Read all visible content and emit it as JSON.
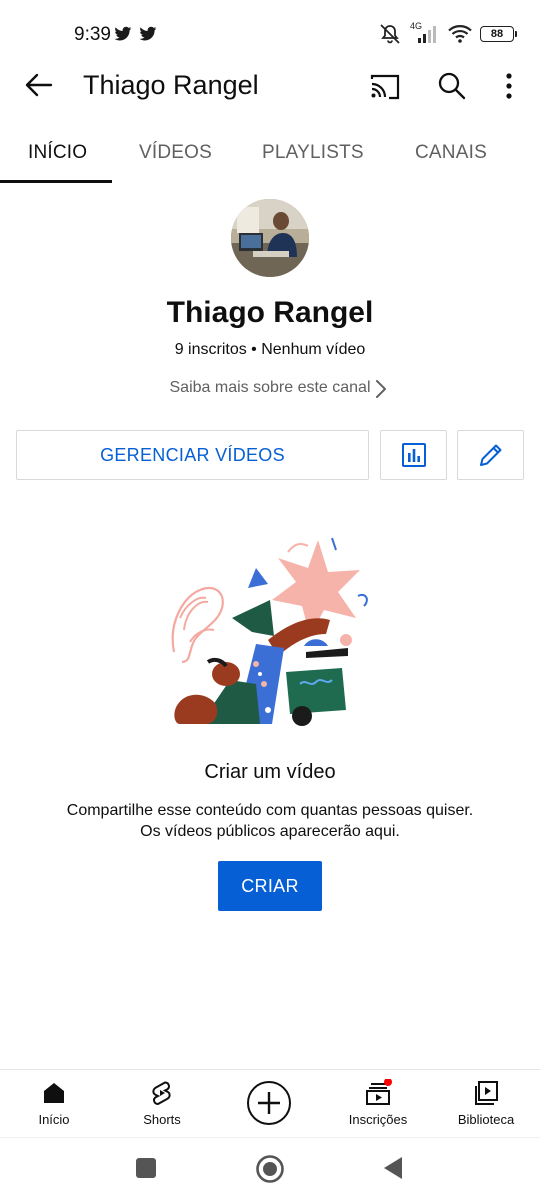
{
  "status_bar": {
    "time": "9:39",
    "network": "4G",
    "battery": "88"
  },
  "app_bar": {
    "title": "Thiago Rangel"
  },
  "tabs": [
    {
      "label": "INÍCIO",
      "active": true
    },
    {
      "label": "VÍDEOS",
      "active": false
    },
    {
      "label": "PLAYLISTS",
      "active": false
    },
    {
      "label": "CANAIS",
      "active": false
    }
  ],
  "channel": {
    "name": "Thiago Rangel",
    "stats": "9 inscritos • Nenhum vídeo",
    "about_link": "Saiba mais sobre este canal"
  },
  "actions": {
    "manage_label": "GERENCIAR VÍDEOS"
  },
  "empty_state": {
    "title": "Criar um vídeo",
    "description_line1": "Compartilhe esse conteúdo com quantas pessoas quiser.",
    "description_line2": "Os vídeos públicos aparecerão aqui.",
    "create_label": "CRIAR"
  },
  "bottom_nav": [
    {
      "label": "Início",
      "icon": "home-icon"
    },
    {
      "label": "Shorts",
      "icon": "shorts-icon"
    },
    {
      "label": "",
      "icon": "create-plus-icon"
    },
    {
      "label": "Inscrições",
      "icon": "subscriptions-icon"
    },
    {
      "label": "Biblioteca",
      "icon": "library-icon"
    }
  ],
  "colors": {
    "accent": "#065fd4",
    "text": "#0f0f0f",
    "secondary_text": "#606060",
    "notification_dot": "#ff0000"
  }
}
